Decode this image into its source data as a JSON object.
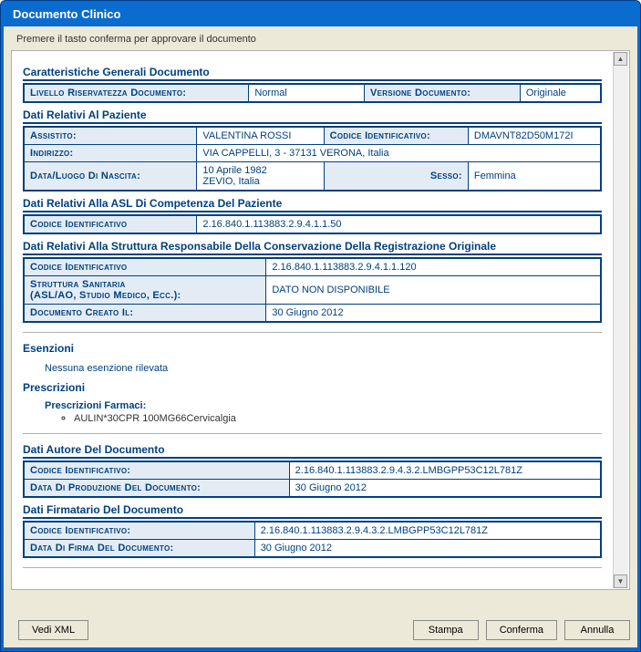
{
  "window": {
    "title": "Documento Clinico"
  },
  "instruction": "Premere il tasto conferma per approvare il documento",
  "sections": {
    "caratteristiche": {
      "title": "Caratteristiche Generali Documento",
      "livello_riserv_label": "Livello Riservatezza Documento:",
      "livello_riserv_value": "Normal",
      "versione_label": "Versione Documento:",
      "versione_value": "Originale"
    },
    "paziente": {
      "title": "Dati Relativi Al Paziente",
      "assistito_label": "Assistito:",
      "assistito_value": "VALENTINA ROSSI",
      "codice_label": "Codice Identificativo:",
      "codice_value": "DMAVNT82D50M172I",
      "indirizzo_label": "Indirizzo:",
      "indirizzo_value": "VIA CAPPELLI, 3 - 37131 VERONA, Italia",
      "nascita_label": "Data/Luogo Di Nascita:",
      "nascita_data": "10 Aprile 1982",
      "nascita_luogo": "ZEVIO, Italia",
      "sesso_label": "Sesso:",
      "sesso_value": "Femmina"
    },
    "asl": {
      "title": "Dati Relativi Alla ASL Di Competenza Del Paziente",
      "codice_label": "Codice Identificativo",
      "codice_value": "2.16.840.1.113883.2.9.4.1.1.50"
    },
    "struttura": {
      "title": "Dati Relativi Alla Struttura Responsabile Della Conservazione Della Registrazione Originale",
      "codice_label": "Codice Identificativo",
      "codice_value": "2.16.840.1.113883.2.9.4.1.1.120",
      "struttura_label_l1": "Struttura Sanitaria",
      "struttura_label_l2": "(ASL/AO, Studio Medico, Ecc.):",
      "struttura_value": "DATO NON DISPONIBILE",
      "creato_label": "Documento Creato Il:",
      "creato_value": "30 Giugno 2012"
    },
    "esenzioni": {
      "title": "Esenzioni",
      "text": "Nessuna esenzione rilevata"
    },
    "prescrizioni": {
      "title": "Prescrizioni",
      "farmaci_label": "Prescrizioni Farmaci:",
      "items": [
        "AULIN*30CPR 100MG66Cervicalgia"
      ]
    },
    "autore": {
      "title": "Dati Autore Del Documento",
      "codice_label": "Codice Identificativo:",
      "codice_value": "2.16.840.1.113883.2.9.4.3.2.LMBGPP53C12L781Z",
      "data_label": "Data Di Produzione Del Documento:",
      "data_value": "30 Giugno 2012"
    },
    "firmatario": {
      "title": "Dati Firmatario Del Documento",
      "codice_label": "Codice Identificativo:",
      "codice_value": "2.16.840.1.113883.2.9.4.3.2.LMBGPP53C12L781Z",
      "data_label": "Data Di Firma Del Documento:",
      "data_value": "30 Giugno 2012"
    }
  },
  "buttons": {
    "vedi_xml": "Vedi XML",
    "stampa": "Stampa",
    "conferma": "Conferma",
    "annulla": "Annulla"
  }
}
